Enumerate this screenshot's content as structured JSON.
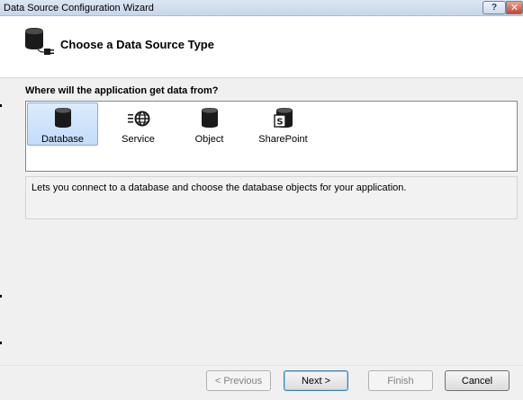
{
  "window": {
    "title": "Data Source Configuration Wizard"
  },
  "titlebar": {
    "help_label": "?",
    "close_label": "✕"
  },
  "header": {
    "title": "Choose a Data Source Type",
    "icon": "database-plug-icon"
  },
  "prompt": "Where will the application get data from?",
  "source_types": [
    {
      "label": "Database",
      "icon": "database-icon",
      "selected": true
    },
    {
      "label": "Service",
      "icon": "web-service-icon",
      "selected": false
    },
    {
      "label": "Object",
      "icon": "object-icon",
      "selected": false
    },
    {
      "label": "SharePoint",
      "icon": "sharepoint-icon",
      "selected": false
    }
  ],
  "description": "Lets you connect to a database and choose the database objects for your application.",
  "buttons": {
    "previous": "< Previous",
    "next": "Next >",
    "finish": "Finish",
    "cancel": "Cancel"
  },
  "colors": {
    "selection": "#c2dcfb",
    "selection_border": "#84acdd",
    "default_button_border": "#3c7fb1"
  }
}
